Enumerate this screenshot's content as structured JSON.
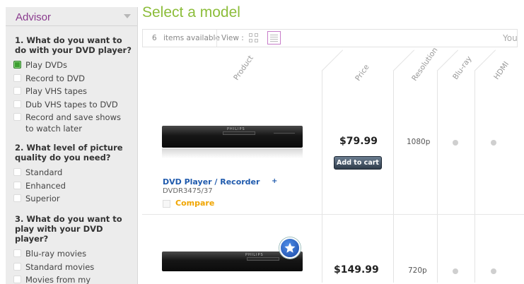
{
  "advisor": {
    "title": "Advisor",
    "questions": [
      {
        "text_lines": [
          "1. What do you want to",
          "do with your DVD player?"
        ],
        "options": [
          {
            "label": "Play DVDs",
            "checked": true
          },
          {
            "label": "Record to DVD",
            "checked": false
          },
          {
            "label": "Play VHS tapes",
            "checked": false
          },
          {
            "label": "Dub VHS tapes to DVD",
            "checked": false
          },
          {
            "label_lines": [
              "Record and save shows",
              "to watch later"
            ],
            "checked": false
          }
        ]
      },
      {
        "text_lines": [
          "2. What level of picture",
          "quality do you need?"
        ],
        "options": [
          {
            "label": "Standard",
            "checked": false
          },
          {
            "label": "Enhanced",
            "checked": false
          },
          {
            "label": "Superior",
            "checked": false
          }
        ]
      },
      {
        "text_lines": [
          "3. What do you want to",
          "play with your DVD",
          "player?"
        ],
        "options": [
          {
            "label": "Blu-ray movies",
            "checked": false
          },
          {
            "label": "Standard movies",
            "checked": false
          },
          {
            "label": "Movies from my",
            "checked": false
          }
        ]
      }
    ]
  },
  "main": {
    "title": "Select a model",
    "toolbar": {
      "count": "6",
      "items_label": "items available",
      "view_label": "View :",
      "right_text": "You"
    },
    "columns": [
      "Product",
      "Price",
      "Resolution",
      "Blu-ray",
      "HDMI"
    ],
    "products": [
      {
        "name": "DVD Player / Recorder",
        "plus": "+",
        "model": "DVDR3475/37",
        "compare": "Compare",
        "price": "$79.99",
        "cart": "Add to cart",
        "resolution": "1080p",
        "brand": "PHILIPS"
      },
      {
        "price": "$149.99",
        "resolution": "720p",
        "brand": "PHILIPS"
      }
    ],
    "colors": {
      "title": "#8cbd3a",
      "advisor_title": "#8a3b8e",
      "link": "#1f5aad",
      "compare": "#f0a500"
    }
  }
}
